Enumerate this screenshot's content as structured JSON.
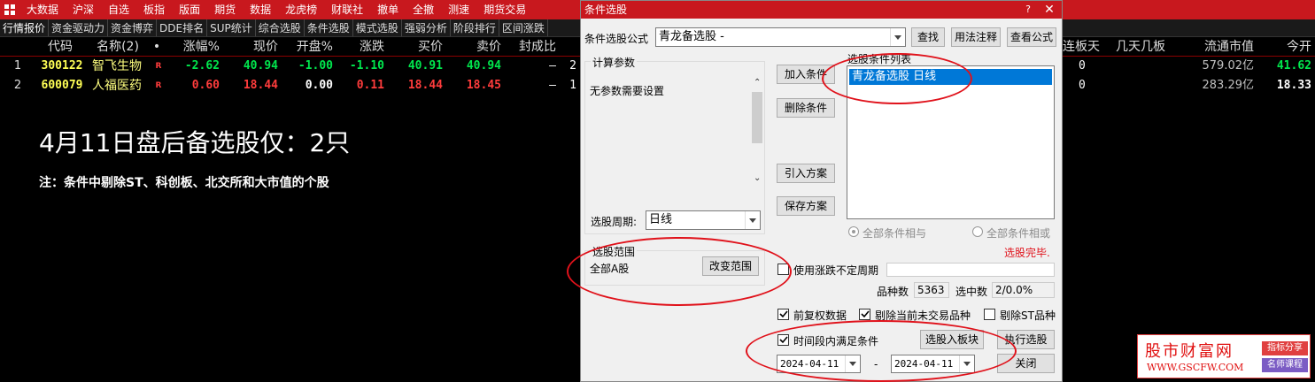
{
  "menu": [
    "大数据",
    "沪深",
    "自选",
    "板指",
    "版面",
    "期货",
    "数据",
    "龙虎榜",
    "财联社",
    "撤单",
    "全撤",
    "测速",
    "期货交易"
  ],
  "tabs": [
    "行情报价",
    "资金驱动力",
    "资金博弈",
    "DDE排名",
    "SUP统计",
    "综合选股",
    "条件选股",
    "模式选股",
    "强弱分析",
    "阶段排行",
    "区间涨跌"
  ],
  "table": {
    "headers": [
      "",
      "代码",
      "名称(2)",
      "•",
      "涨幅%",
      "现价",
      "开盘%",
      "涨跌",
      "买价",
      "卖价",
      "封成比"
    ],
    "right_headers": [
      "连板天",
      "几天几板",
      "流通市值",
      "今开"
    ],
    "rows": [
      {
        "num": "1",
        "code": "300122",
        "name": "智飞生物",
        "mark": "R",
        "chg_pct": "-2.62",
        "price": "40.94",
        "open_pct": "-1.00",
        "chg": "-1.10",
        "bid": "40.91",
        "ask": "40.94",
        "seal": "–",
        "extra": "2",
        "lianban": "0",
        "jitian": "",
        "mktcap": "579.02亿",
        "open": "41.62"
      },
      {
        "num": "2",
        "code": "600079",
        "name": "人福医药",
        "mark": "R",
        "chg_pct": "0.60",
        "price": "18.44",
        "open_pct": "0.00",
        "chg": "0.11",
        "bid": "18.44",
        "ask": "18.45",
        "seal": "–",
        "extra": "1",
        "lianban": "0",
        "jitian": "",
        "mktcap": "283.29亿",
        "open": "18.33"
      }
    ]
  },
  "headline": "4月11日盘后备选股仅：2只",
  "note": "注：条件中剔除ST、科创板、北交所和大市值的个股",
  "dialog": {
    "title": "条件选股",
    "formula_label": "条件选股公式",
    "formula_value": "青龙备选股  -",
    "find_btn": "查找",
    "usage_btn": "用法注释",
    "view_formula_btn": "查看公式",
    "calc_params_title": "计算参数",
    "no_params": "无参数需要设置",
    "period_label": "选股周期:",
    "period_value": "日线",
    "add_cond_btn": "加入条件",
    "del_cond_btn": "删除条件",
    "import_plan_btn": "引入方案",
    "save_plan_btn": "保存方案",
    "cond_list_title": "选股条件列表",
    "cond_item": "青龙备选股  日线",
    "radio_and": "全部条件相与",
    "radio_or": "全部条件相或",
    "status": "选股完毕.",
    "scope_title": "选股范围",
    "scope_value": "全部A股",
    "change_scope_btn": "改变范围",
    "use_irregular_period": "使用涨跌不定周期",
    "count_label": "品种数",
    "count_value": "5363",
    "selected_label": "选中数",
    "selected_value": "2/0.0%",
    "adj_data": "前复权数据",
    "exclude_untraded": "剔除当前未交易品种",
    "exclude_st": "剔除ST品种",
    "time_range_cond": "时间段内满足条件",
    "to_board_btn": "选股入板块",
    "run_btn": "执行选股",
    "date_from": "2024-04-11",
    "date_sep": "-",
    "date_to": "2024-04-11",
    "close_btn": "关闭"
  },
  "watermark": {
    "logo": "股市财富网",
    "url": "WWW.GSCFW.COM",
    "tag1": "指标分享",
    "tag2": "名师课程"
  },
  "colors": {
    "menu_bg": "#c8181e",
    "annotation_red": "#e0121b",
    "selection_blue": "#0078d7",
    "up_red": "#ff3c3c",
    "down_green": "#00e64d"
  }
}
